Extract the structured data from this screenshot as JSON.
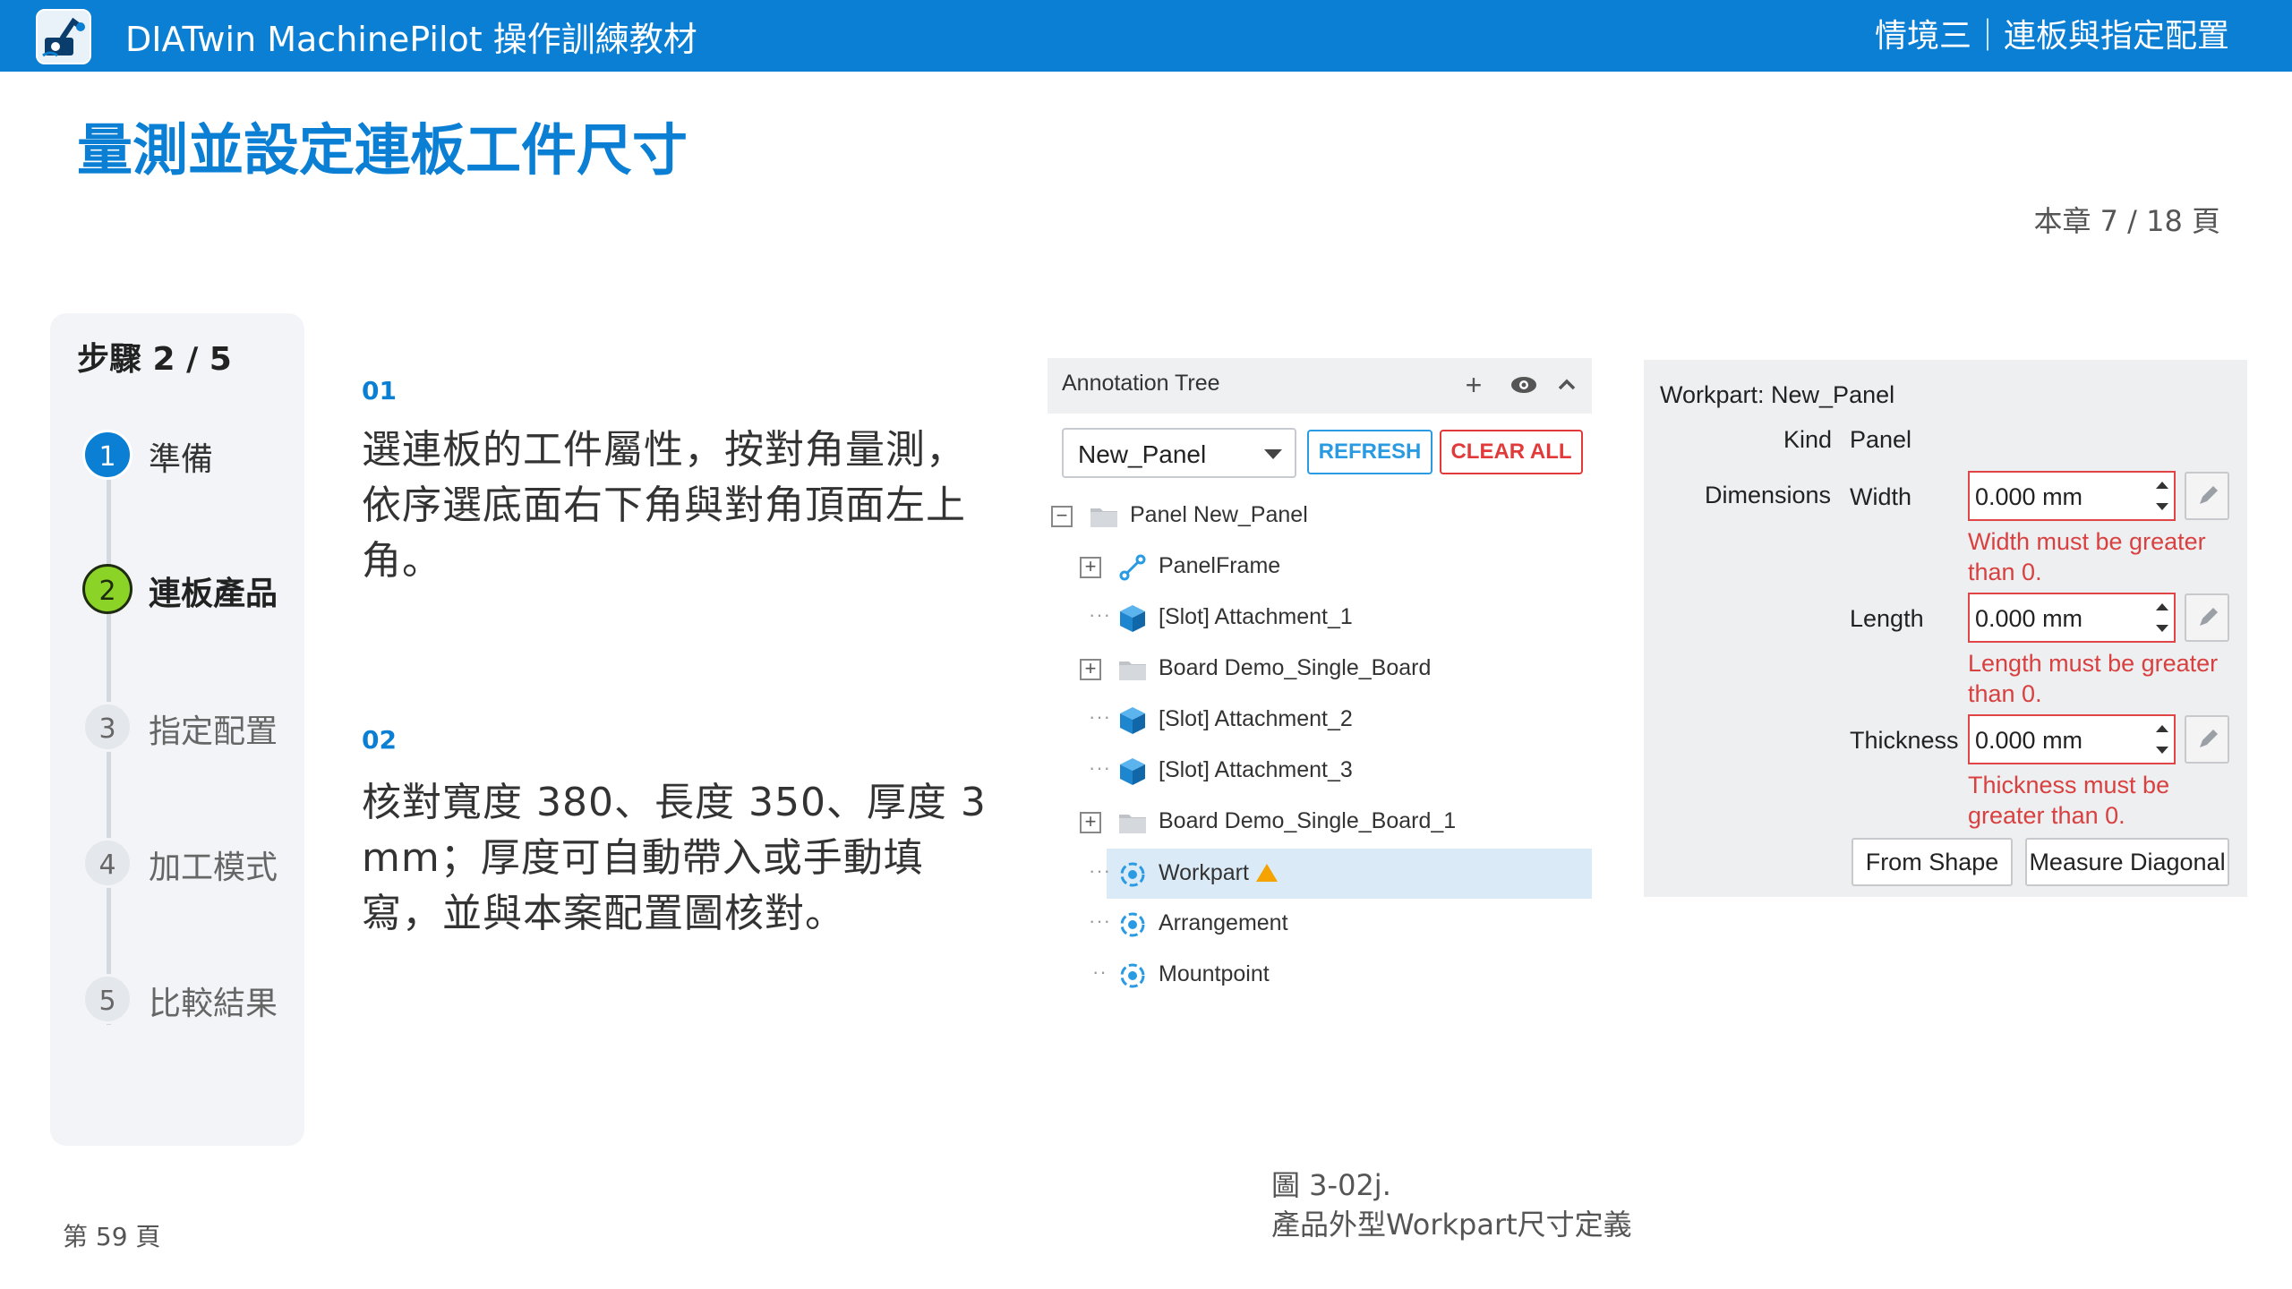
{
  "header": {
    "app_title": "DIATwin MachinePilot 操作訓練教材",
    "chapter": "情境三｜連板與指定配置"
  },
  "page_title": "量測並設定連板工件尺寸",
  "chapter_page": "本章 7 / 18 頁",
  "steps": {
    "heading": "步驟 2 / 5",
    "items": [
      {
        "num": "1",
        "label": "準備",
        "state": "done"
      },
      {
        "num": "2",
        "label": "連板產品",
        "state": "active"
      },
      {
        "num": "3",
        "label": "指定配置",
        "state": "pending"
      },
      {
        "num": "4",
        "label": "加工模式",
        "state": "pending"
      },
      {
        "num": "5",
        "label": "比較結果",
        "state": "pending"
      }
    ]
  },
  "instructions": [
    {
      "no": "01",
      "text": "選連板的工件屬性，按對角量測，依序選底面右下角與對角頂面左上角。"
    },
    {
      "no": "02",
      "text": "核對寬度 380、長度 350、厚度 3 mm；厚度可自動帶入或手動填寫，並與本案配置圖核對。"
    }
  ],
  "annotation_tree": {
    "title": "Annotation Tree",
    "selected_panel": "New_Panel",
    "refresh_label": "REFRESH",
    "clear_all_label": "CLEAR ALL",
    "rows": [
      {
        "label": "Panel  New_Panel",
        "icon": "folder-icon",
        "expander": "minus"
      },
      {
        "label": "PanelFrame",
        "icon": "frame-link-icon",
        "expander": "plus"
      },
      {
        "label": "[Slot] Attachment_1",
        "icon": "cube-icon",
        "expander": "dots"
      },
      {
        "label": "Board  Demo_Single_Board",
        "icon": "folder-icon",
        "expander": "plus"
      },
      {
        "label": "[Slot] Attachment_2",
        "icon": "cube-icon",
        "expander": "dots"
      },
      {
        "label": "[Slot] Attachment_3",
        "icon": "cube-icon",
        "expander": "dots"
      },
      {
        "label": "Board  Demo_Single_Board_1",
        "icon": "folder-icon",
        "expander": "plus"
      },
      {
        "label": "Workpart",
        "icon": "target-icon",
        "expander": "dots",
        "selected": true,
        "warning": true
      },
      {
        "label": "Arrangement",
        "icon": "target-icon",
        "expander": "dots"
      },
      {
        "label": "Mountpoint",
        "icon": "target-icon",
        "expander": "dots"
      }
    ]
  },
  "workpart": {
    "title": "Workpart: New_Panel",
    "kind_label": "Kind",
    "kind_value": "Panel",
    "dimensions_label": "Dimensions",
    "width_label": "Width",
    "width_value": "0.000 mm",
    "width_error": "Width must be greater than 0.",
    "length_label": "Length",
    "length_value": "0.000 mm",
    "length_error": "Length must be greater than 0.",
    "thickness_label": "Thickness",
    "thickness_value": "0.000 mm",
    "thickness_error": "Thickness must be greater than 0.",
    "from_shape_label": "From Shape",
    "measure_diagonal_label": "Measure Diagonal"
  },
  "caption": {
    "line1": "圖 3-02j.",
    "line2": "產品外型Workpart尺寸定義"
  },
  "page_number": "第 59 頁",
  "colors": {
    "brand_blue": "#0a7fd3",
    "active_step": "#8bd326",
    "error_red": "#d94040"
  }
}
